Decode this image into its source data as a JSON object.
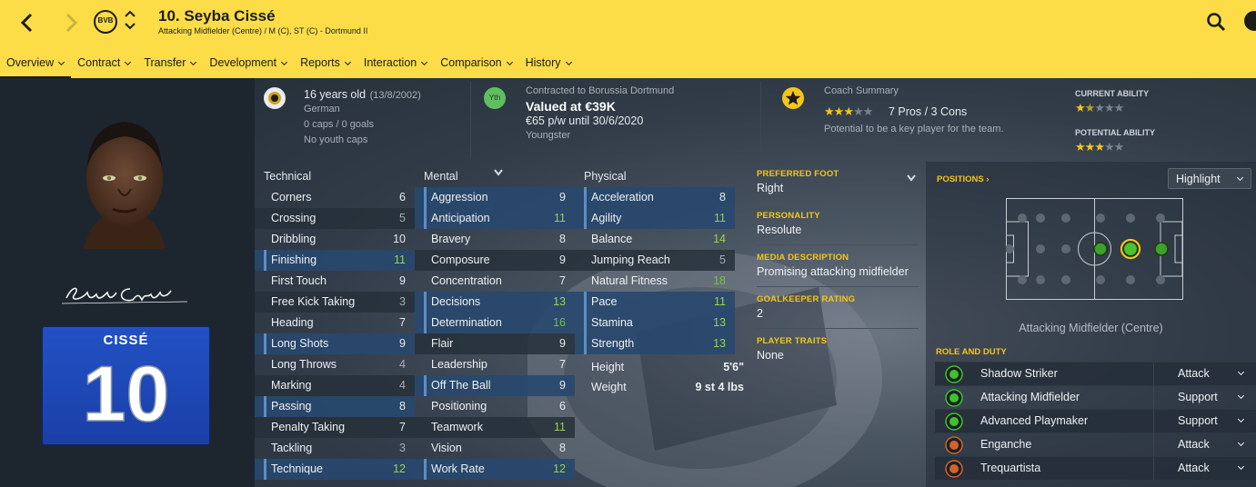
{
  "header": {
    "name": "10. Seyba Cissé",
    "subtitle": "Attacking Midfielder (Centre) / M (C), ST (C) - Dortmund II",
    "club_badge_text": "BVB",
    "back_icon": "back-arrow-icon",
    "forward_icon": "forward-arrow-icon",
    "search_icon": "search-icon",
    "globe_icon": "globe-icon",
    "accent_color": "#fcdd48"
  },
  "menu": [
    "Overview",
    "Contract",
    "Transfer",
    "Development",
    "Reports",
    "Interaction",
    "Comparison",
    "History"
  ],
  "left": {
    "shirt_name": "CISSÉ",
    "shirt_number": "10",
    "shirt_color": "#2251c4"
  },
  "info": {
    "age": "16 years old",
    "dob": "(13/8/2002)",
    "nationality": "German",
    "caps": "0 caps / 0 goals",
    "youth_caps": "No youth caps",
    "yth_badge": "Yth",
    "contract_line": "Contracted to Borussia Dortmund",
    "value": "Valued at €39K",
    "wage": "€65 p/w until 30/6/2020",
    "status": "Youngster",
    "coach_title": "Coach Summary",
    "pros_cons": "7 Pros / 3 Cons",
    "coach_note": "Potential to be a key player for the team.",
    "coach_stars": 3,
    "current_ability_label": "CURRENT ABILITY",
    "current_ability_stars": 1.5,
    "potential_ability_label": "POTENTIAL ABILITY",
    "potential_ability_stars": 3
  },
  "attributes": {
    "technical_title": "Technical",
    "mental_title": "Mental",
    "physical_title": "Physical",
    "technical": [
      {
        "name": "Corners",
        "value": "6"
      },
      {
        "name": "Crossing",
        "value": "5"
      },
      {
        "name": "Dribbling",
        "value": "10"
      },
      {
        "name": "Finishing",
        "value": "11"
      },
      {
        "name": "First Touch",
        "value": "9"
      },
      {
        "name": "Free Kick Taking",
        "value": "3"
      },
      {
        "name": "Heading",
        "value": "7"
      },
      {
        "name": "Long Shots",
        "value": "9"
      },
      {
        "name": "Long Throws",
        "value": "4"
      },
      {
        "name": "Marking",
        "value": "4"
      },
      {
        "name": "Passing",
        "value": "8"
      },
      {
        "name": "Penalty Taking",
        "value": "7"
      },
      {
        "name": "Tackling",
        "value": "3"
      },
      {
        "name": "Technique",
        "value": "12"
      }
    ],
    "mental": [
      {
        "name": "Aggression",
        "value": "9"
      },
      {
        "name": "Anticipation",
        "value": "11"
      },
      {
        "name": "Bravery",
        "value": "8"
      },
      {
        "name": "Composure",
        "value": "9"
      },
      {
        "name": "Concentration",
        "value": "7"
      },
      {
        "name": "Decisions",
        "value": "13"
      },
      {
        "name": "Determination",
        "value": "16"
      },
      {
        "name": "Flair",
        "value": "9"
      },
      {
        "name": "Leadership",
        "value": "7"
      },
      {
        "name": "Off The Ball",
        "value": "9"
      },
      {
        "name": "Positioning",
        "value": "6"
      },
      {
        "name": "Teamwork",
        "value": "11"
      },
      {
        "name": "Vision",
        "value": "8"
      },
      {
        "name": "Work Rate",
        "value": "12"
      }
    ],
    "physical": [
      {
        "name": "Acceleration",
        "value": "8"
      },
      {
        "name": "Agility",
        "value": "11"
      },
      {
        "name": "Balance",
        "value": "14"
      },
      {
        "name": "Jumping Reach",
        "value": "5"
      },
      {
        "name": "Natural Fitness",
        "value": "18"
      },
      {
        "name": "Pace",
        "value": "11"
      },
      {
        "name": "Stamina",
        "value": "13"
      },
      {
        "name": "Strength",
        "value": "13"
      }
    ],
    "height_label": "Height",
    "height": "5'6\"",
    "weight_label": "Weight",
    "weight": "9 st 4 lbs"
  },
  "details": {
    "preferred_foot_label": "PREFERRED FOOT",
    "preferred_foot": "Right",
    "personality_label": "PERSONALITY",
    "personality": "Resolute",
    "media_label": "MEDIA DESCRIPTION",
    "media": "Promising attacking midfielder",
    "gk_label": "GOALKEEPER RATING",
    "gk": "2",
    "traits_label": "PLAYER TRAITS",
    "traits": "None"
  },
  "positions": {
    "label": "POSITIONS",
    "highlight": "Highlight",
    "caption": "Attacking Midfielder (Centre)"
  },
  "roles": {
    "label": "ROLE AND DUTY",
    "items": [
      {
        "name": "Shadow Striker",
        "duty": "Attack",
        "rating": "good"
      },
      {
        "name": "Attacking Midfielder",
        "duty": "Support",
        "rating": "good"
      },
      {
        "name": "Advanced Playmaker",
        "duty": "Support",
        "rating": "good"
      },
      {
        "name": "Enganche",
        "duty": "Attack",
        "rating": "poor"
      },
      {
        "name": "Trequartista",
        "duty": "Attack",
        "rating": "poor"
      }
    ]
  }
}
